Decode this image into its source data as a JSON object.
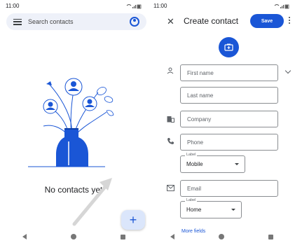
{
  "colors": {
    "accent": "#1a56d6",
    "search_bg": "#eef1f9",
    "fab_bg": "#dbe6fb"
  },
  "left_screen": {
    "status": {
      "time": "11:00"
    },
    "search": {
      "placeholder": "Search contacts",
      "menu_icon": "menu-icon",
      "account_icon": "account-circle-icon"
    },
    "empty_state": {
      "text": "No contacts yet"
    },
    "fab": {
      "label": "+"
    }
  },
  "right_screen": {
    "status": {
      "time": "11:00"
    },
    "header": {
      "close_label": "✕",
      "title": "Create contact",
      "save_label": "Save"
    },
    "form": {
      "first_name_placeholder": "First name",
      "last_name_placeholder": "Last name",
      "company_placeholder": "Company",
      "phone_placeholder": "Phone",
      "phone_label_caption": "Label",
      "phone_label_value": "Mobile",
      "email_placeholder": "Email",
      "email_label_caption": "Label",
      "email_label_value": "Home"
    },
    "more_fields_label": "More fields"
  }
}
